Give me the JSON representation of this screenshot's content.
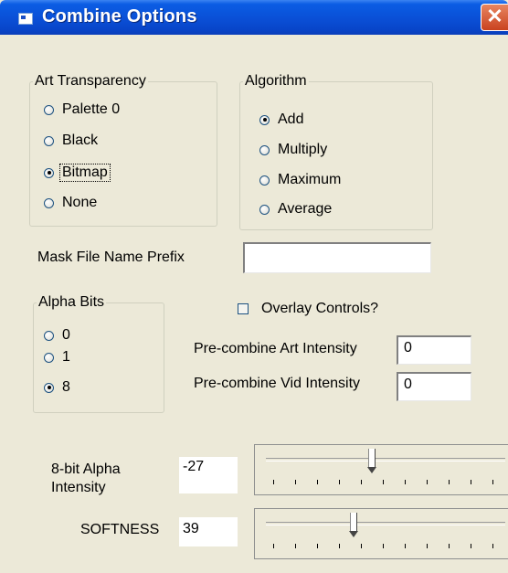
{
  "window": {
    "title": "Combine Options",
    "close_glyph": "✕",
    "icon": "app-window-icon"
  },
  "art_transparency": {
    "legend": "Art Transparency",
    "options": [
      {
        "label": "Palette 0",
        "selected": false
      },
      {
        "label": "Black",
        "selected": false
      },
      {
        "label": "Bitmap",
        "selected": true
      },
      {
        "label": "None",
        "selected": false
      }
    ]
  },
  "algorithm": {
    "legend": "Algorithm",
    "options": [
      {
        "label": "Add",
        "selected": true
      },
      {
        "label": "Multiply",
        "selected": false
      },
      {
        "label": "Maximum",
        "selected": false
      },
      {
        "label": "Average",
        "selected": false
      }
    ]
  },
  "mask": {
    "label": "Mask File Name Prefix",
    "value": ""
  },
  "alpha_bits": {
    "legend": "Alpha Bits",
    "options": [
      {
        "label": "0",
        "selected": false
      },
      {
        "label": "1",
        "selected": false
      },
      {
        "label": "8",
        "selected": true
      }
    ]
  },
  "overlay": {
    "label": "Overlay Controls?",
    "checked": false
  },
  "precombine_art": {
    "label": "Pre-combine Art Intensity",
    "value": "0"
  },
  "precombine_vid": {
    "label": "Pre-combine Vid Intensity",
    "value": "0"
  },
  "alpha_intensity": {
    "label_line1": "8-bit Alpha",
    "label_line2": "Intensity",
    "value": "-27"
  },
  "softness": {
    "label": "SOFTNESS",
    "value": "39"
  }
}
